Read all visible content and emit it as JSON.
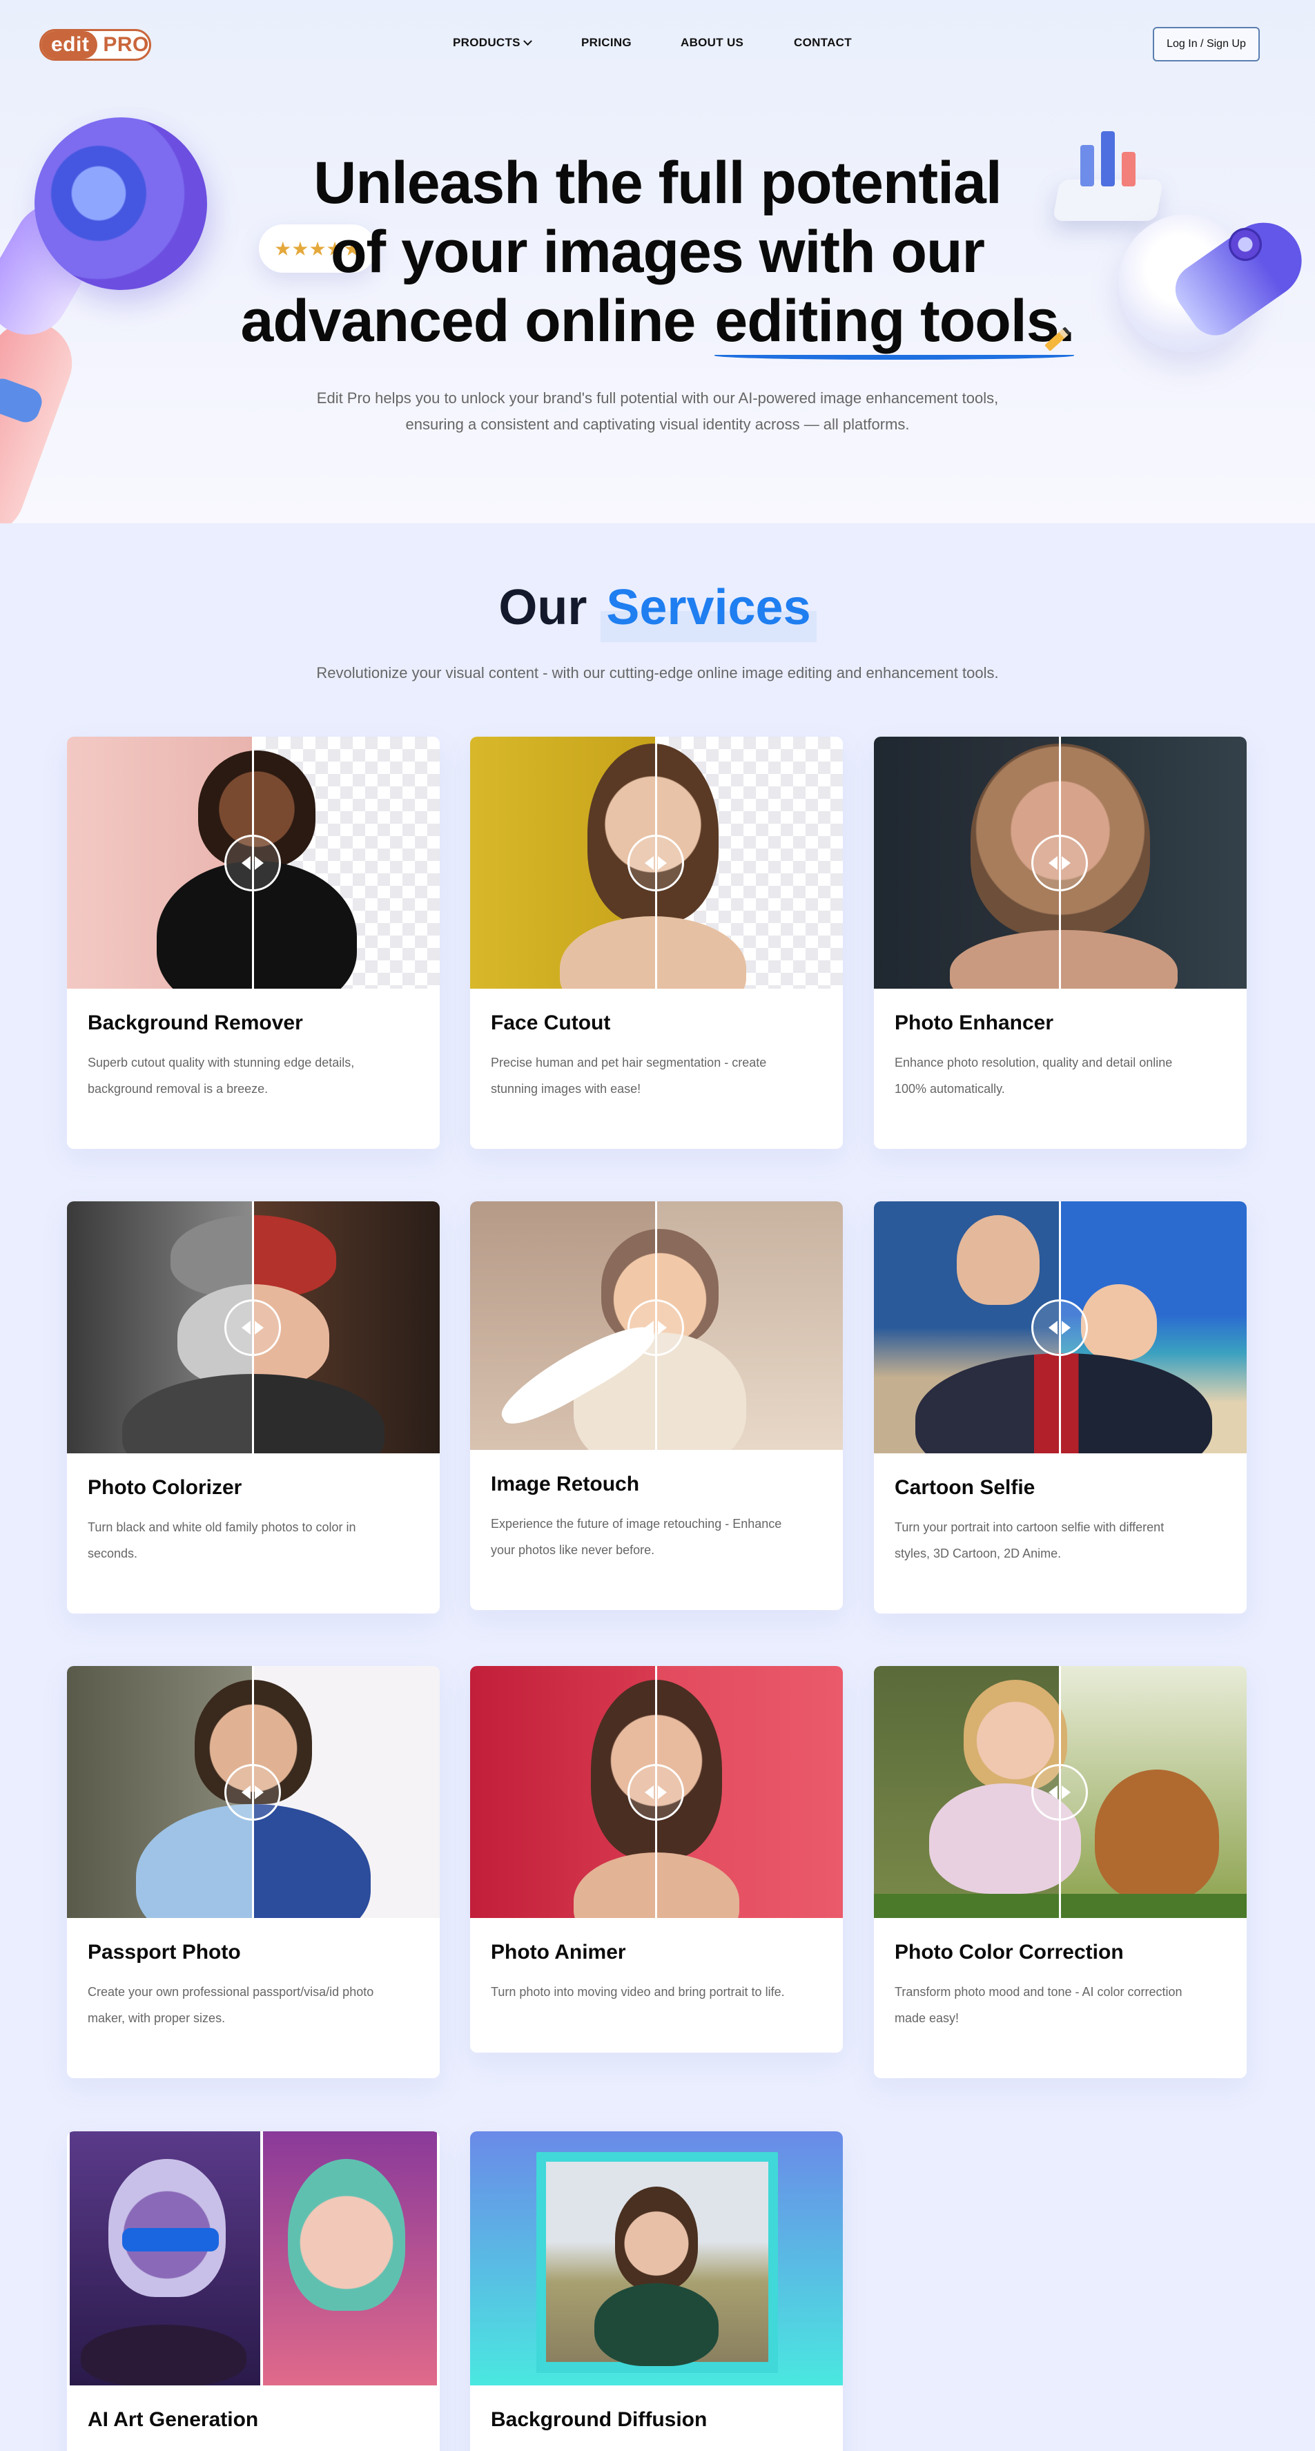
{
  "nav": {
    "logo_edit": "edit",
    "logo_pro": "PRO",
    "links": [
      {
        "label": "PRODUCTS"
      },
      {
        "label": "PRICING"
      },
      {
        "label": "ABOUT US"
      },
      {
        "label": "CONTACT"
      }
    ],
    "login_label": "Log In / Sign Up"
  },
  "hero": {
    "title_line1": "Unleash the full potential",
    "title_line2": "of your images with our",
    "title_line3a": "advanced online",
    "title_line3b": "editing tools.",
    "subtitle_line1": "Edit Pro helps you to unlock your brand's full potential with our AI-powered image enhancement tools,",
    "subtitle_line2": "ensuring a consistent and captivating visual identity across — all platforms.",
    "stars": "★★★★★"
  },
  "services": {
    "title_plain": "Our",
    "title_accent": "Services",
    "subtitle": "Revolutionize your visual content - with our cutting-edge online image editing and enhancement tools.",
    "items": [
      {
        "title": "Background Remover",
        "desc_line1": "Superb cutout quality with stunning edge details,",
        "desc_line2": "background removal is a breeze."
      },
      {
        "title": "Face Cutout",
        "desc_line1": "Precise human and pet hair segmentation - create",
        "desc_line2": "stunning images with ease!"
      },
      {
        "title": "Photo Enhancer",
        "desc_line1": "Enhance photo resolution, quality and detail online",
        "desc_line2": "100% automatically."
      },
      {
        "title": "Photo Colorizer",
        "desc_line1": "Turn black and white old family photos to color in",
        "desc_line2": "seconds."
      },
      {
        "title": "Image Retouch",
        "desc_line1": "Experience the future of image retouching - Enhance",
        "desc_line2": "your photos like never before."
      },
      {
        "title": "Cartoon Selfie",
        "desc_line1": "Turn your portrait into cartoon selfie with different",
        "desc_line2": "styles, 3D Cartoon, 2D Anime."
      },
      {
        "title": "Passport Photo",
        "desc_line1": "Create your own professional passport/visa/id photo",
        "desc_line2": "maker, with proper sizes."
      },
      {
        "title": "Photo Animer",
        "desc_line1": "Turn photo into moving video and bring portrait to life.",
        "desc_line2": ""
      },
      {
        "title": "Photo Color Correction",
        "desc_line1": "Transform photo mood and tone - AI color correction",
        "desc_line2": "made easy!"
      },
      {
        "title": "AI Art Generation",
        "desc_line1": "",
        "desc_line2": ""
      },
      {
        "title": "Background Diffusion",
        "desc_line1": "",
        "desc_line2": ""
      }
    ]
  },
  "colors": {
    "brand": "#c9663b",
    "accent_blue": "#1f7ef0",
    "page_bg": "#eaeefe"
  }
}
